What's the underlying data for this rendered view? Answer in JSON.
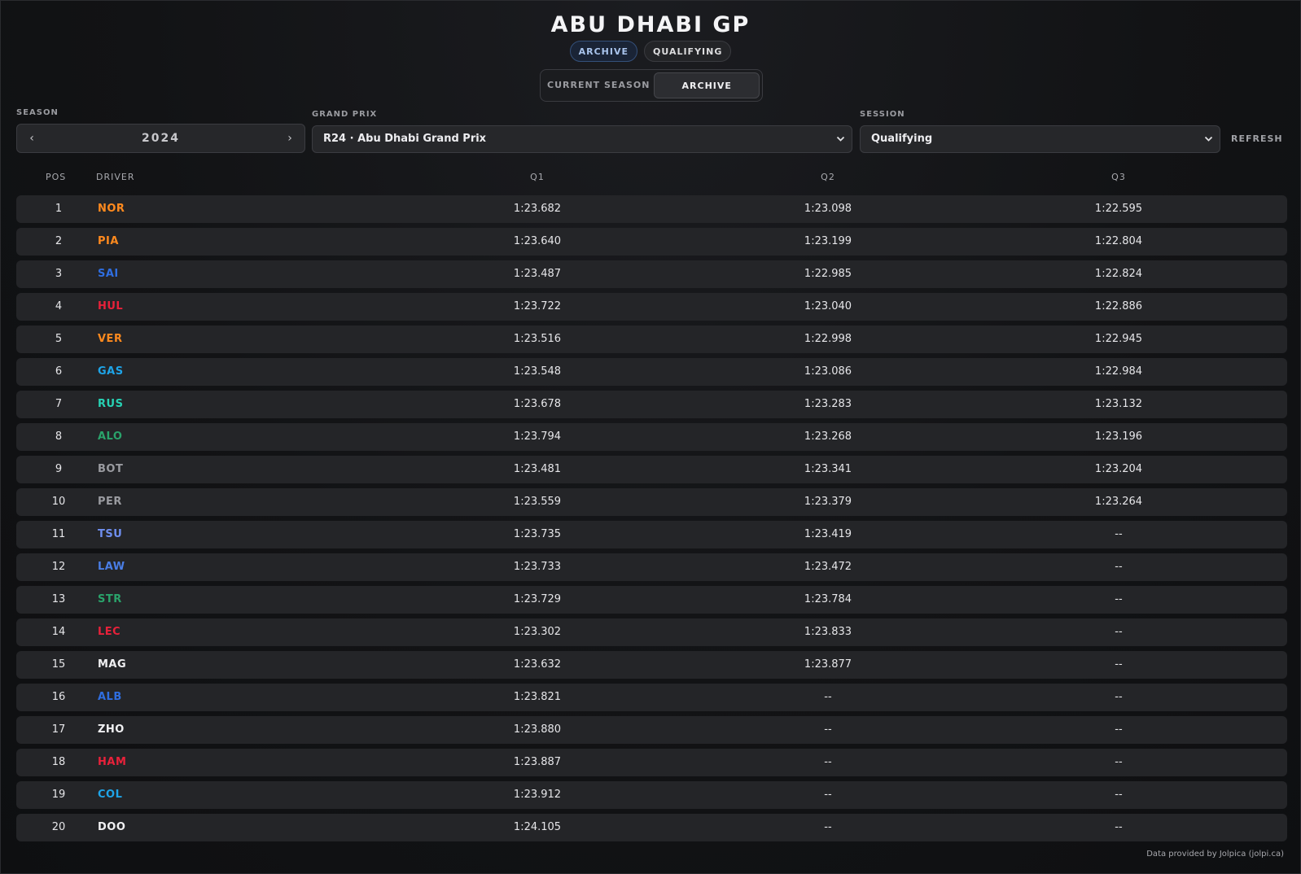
{
  "header": {
    "title": "ABU DHABI GP",
    "pills": [
      "ARCHIVE",
      "QUALIFYING"
    ]
  },
  "mode_toggle": {
    "current_label": "CURRENT SEASON",
    "archive_label": "ARCHIVE",
    "selected": "archive"
  },
  "filters": {
    "season_label": "SEASON",
    "season_value": "2024",
    "prev_glyph": "‹",
    "next_glyph": "›",
    "gp_label": "GRAND PRIX",
    "gp_value": "R24 · Abu Dhabi Grand Prix",
    "session_label": "SESSION",
    "session_value": "Qualifying",
    "refresh_label": "REFRESH"
  },
  "table": {
    "columns": [
      "POS",
      "DRIVER",
      "Q1",
      "Q2",
      "Q3"
    ],
    "rows": [
      {
        "pos": "1",
        "driver": "NOR",
        "color": "#ff8a1e",
        "q1": "1:23.682",
        "q2": "1:23.098",
        "q3": "1:22.595"
      },
      {
        "pos": "2",
        "driver": "PIA",
        "color": "#ff8a1e",
        "q1": "1:23.640",
        "q2": "1:23.199",
        "q3": "1:22.804"
      },
      {
        "pos": "3",
        "driver": "SAI",
        "color": "#2f6ee0",
        "q1": "1:23.487",
        "q2": "1:22.985",
        "q3": "1:22.824"
      },
      {
        "pos": "4",
        "driver": "HUL",
        "color": "#e8213a",
        "q1": "1:23.722",
        "q2": "1:23.040",
        "q3": "1:22.886"
      },
      {
        "pos": "5",
        "driver": "VER",
        "color": "#ff8a1e",
        "q1": "1:23.516",
        "q2": "1:22.998",
        "q3": "1:22.945"
      },
      {
        "pos": "6",
        "driver": "GAS",
        "color": "#1ea4e8",
        "q1": "1:23.548",
        "q2": "1:23.086",
        "q3": "1:22.984"
      },
      {
        "pos": "7",
        "driver": "RUS",
        "color": "#27d2b4",
        "q1": "1:23.678",
        "q2": "1:23.283",
        "q3": "1:23.132"
      },
      {
        "pos": "8",
        "driver": "ALO",
        "color": "#2aa36b",
        "q1": "1:23.794",
        "q2": "1:23.268",
        "q3": "1:23.196"
      },
      {
        "pos": "9",
        "driver": "BOT",
        "color": "#9a9ba0",
        "q1": "1:23.481",
        "q2": "1:23.341",
        "q3": "1:23.204"
      },
      {
        "pos": "10",
        "driver": "PER",
        "color": "#9a9ba0",
        "q1": "1:23.559",
        "q2": "1:23.379",
        "q3": "1:23.264"
      },
      {
        "pos": "11",
        "driver": "TSU",
        "color": "#6f8ff0",
        "q1": "1:23.735",
        "q2": "1:23.419",
        "q3": "--"
      },
      {
        "pos": "12",
        "driver": "LAW",
        "color": "#4a7ee6",
        "q1": "1:23.733",
        "q2": "1:23.472",
        "q3": "--"
      },
      {
        "pos": "13",
        "driver": "STR",
        "color": "#2aa36b",
        "q1": "1:23.729",
        "q2": "1:23.784",
        "q3": "--"
      },
      {
        "pos": "14",
        "driver": "LEC",
        "color": "#e8213a",
        "q1": "1:23.302",
        "q2": "1:23.833",
        "q3": "--"
      },
      {
        "pos": "15",
        "driver": "MAG",
        "color": "#f0f0f2",
        "q1": "1:23.632",
        "q2": "1:23.877",
        "q3": "--"
      },
      {
        "pos": "16",
        "driver": "ALB",
        "color": "#2f6ee0",
        "q1": "1:23.821",
        "q2": "--",
        "q3": "--"
      },
      {
        "pos": "17",
        "driver": "ZHO",
        "color": "#f0f0f2",
        "q1": "1:23.880",
        "q2": "--",
        "q3": "--"
      },
      {
        "pos": "18",
        "driver": "HAM",
        "color": "#e8213a",
        "q1": "1:23.887",
        "q2": "--",
        "q3": "--"
      },
      {
        "pos": "19",
        "driver": "COL",
        "color": "#1ea4e8",
        "q1": "1:23.912",
        "q2": "--",
        "q3": "--"
      },
      {
        "pos": "20",
        "driver": "DOO",
        "color": "#f0f0f2",
        "q1": "1:24.105",
        "q2": "--",
        "q3": "--"
      }
    ]
  },
  "footer": {
    "credit": "Data provided by Jolpica (jolpi.ca)"
  }
}
